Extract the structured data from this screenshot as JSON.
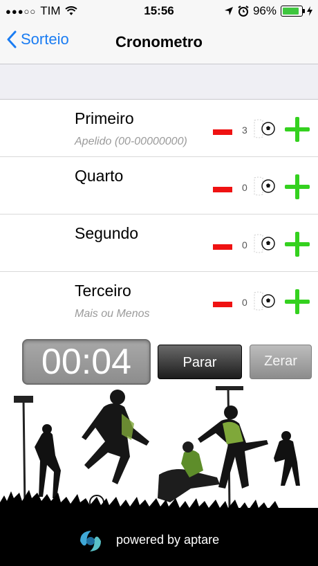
{
  "status_bar": {
    "signal_dots": "●●●○○",
    "carrier": "TIM",
    "time": "15:56",
    "battery_percent": "96%",
    "battery_level": 0.96,
    "icons": [
      "wifi-icon",
      "location-arrow-icon",
      "alarm-clock-icon",
      "battery-icon",
      "charging-bolt-icon"
    ]
  },
  "navbar": {
    "back_label": "Sorteio",
    "title": "Cronometro"
  },
  "players": [
    {
      "name": "Primeiro",
      "subtitle": "Apelido (00-00000000)",
      "goals": "3"
    },
    {
      "name": "Quarto",
      "subtitle": "",
      "goals": "0"
    },
    {
      "name": "Segundo",
      "subtitle": "",
      "goals": "0"
    },
    {
      "name": "Terceiro",
      "subtitle": "Mais ou Menos",
      "goals": "0"
    }
  ],
  "timer": {
    "display": "00:04",
    "stop_label": "Parar",
    "reset_label": "Zerar"
  },
  "footer": {
    "powered_by": "powered by aptare"
  },
  "colors": {
    "accent": "#1a7cf2",
    "minus": "#ef1212",
    "plus": "#34d11f",
    "battery": "#3ec63e"
  }
}
